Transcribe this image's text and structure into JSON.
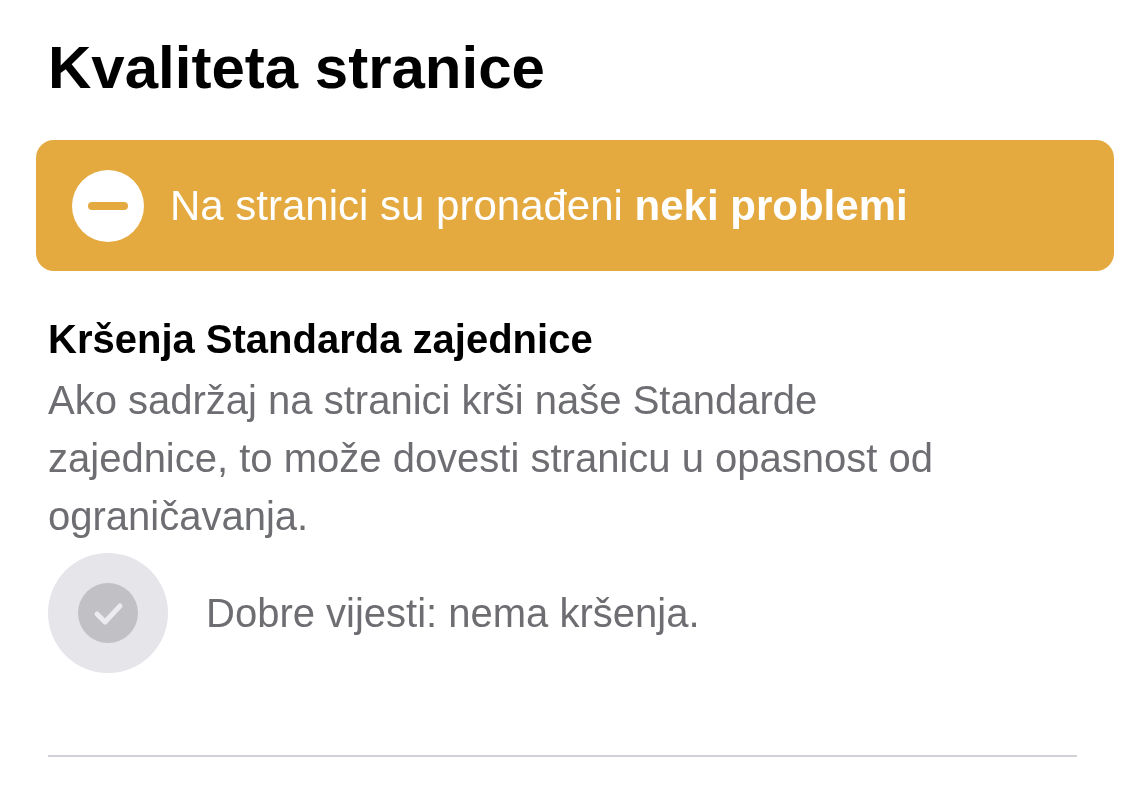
{
  "title": "Kvaliteta stranice",
  "banner": {
    "kind": "warning",
    "text": "Na stranici su pronađeni **neki problemi**"
  },
  "section": {
    "heading": "Kršenja Standarda zajednice",
    "description": "Ako sadržaj na stranici krši naše Standarde zajednice, to može dovesti stranicu u opasnost od ograničavanja.",
    "result": {
      "kind": "ok",
      "text": "Dobre vijesti: nema kršenja."
    }
  }
}
